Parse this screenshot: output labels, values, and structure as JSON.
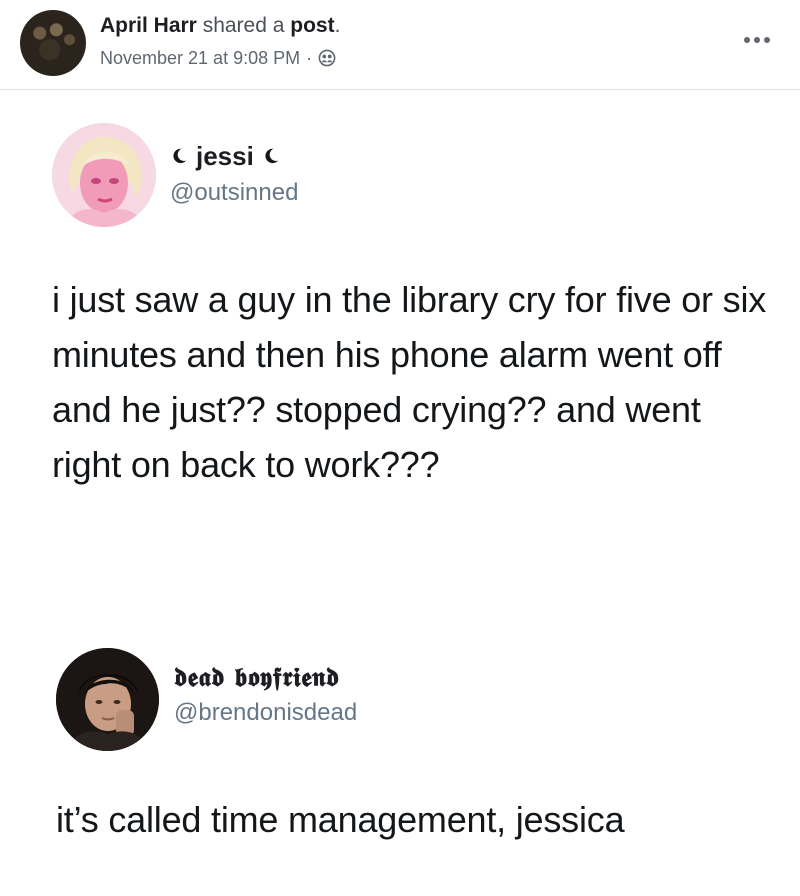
{
  "post_header": {
    "author": "April Harr",
    "action": "shared a",
    "object": "post",
    "punctuation": ".",
    "timestamp": "November 21 at 9:08 PM",
    "separator": "·",
    "audience_icon": "friends-icon",
    "more_icon": "more-options-icon"
  },
  "tweets": [
    {
      "display_name": "jessi",
      "name_decoration_icon": "crescent-moon-icon",
      "handle": "@outsinned",
      "text": "i just saw a guy in the library cry for five or six minutes and then his phone alarm went off and he just?? stopped crying?? and went right on back to work???"
    },
    {
      "display_name": "𝖉𝖊𝖆𝖉 𝖇𝖔𝖞𝖋𝖗𝖎𝖊𝖓𝖉",
      "handle": "@brendonisdead",
      "text": "it’s called time management, jessica"
    }
  ],
  "colors": {
    "text_primary": "#1c1e21",
    "text_secondary": "#616770",
    "twitter_handle": "#657786",
    "divider": "#dadde1"
  }
}
